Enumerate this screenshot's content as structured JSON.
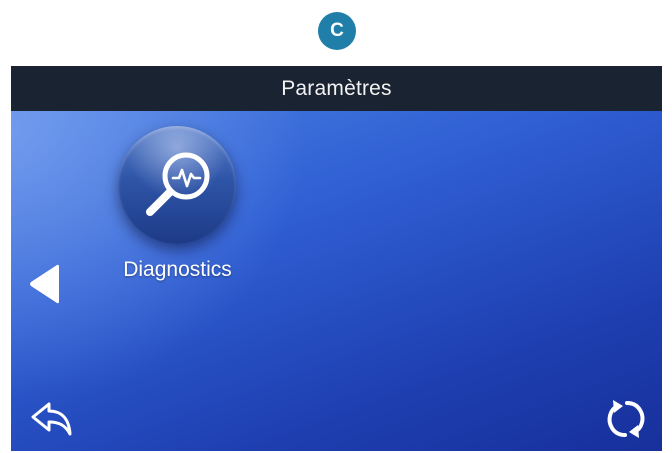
{
  "marker": {
    "label": "C",
    "color": "#1f7fa8"
  },
  "header": {
    "title": "Paramètres"
  },
  "menu": {
    "items": [
      {
        "label": "Diagnostics",
        "icon": "magnifier-pulse-icon"
      }
    ]
  },
  "navigation": {
    "prev_icon": "triangle-left-icon",
    "back_icon": "back-arrow-icon",
    "refresh_icon": "refresh-icon"
  },
  "colors": {
    "titlebar": "#1a2331",
    "screen_light": "#4f85e6",
    "screen_dark": "#17309b",
    "icon_white": "#ffffff"
  }
}
